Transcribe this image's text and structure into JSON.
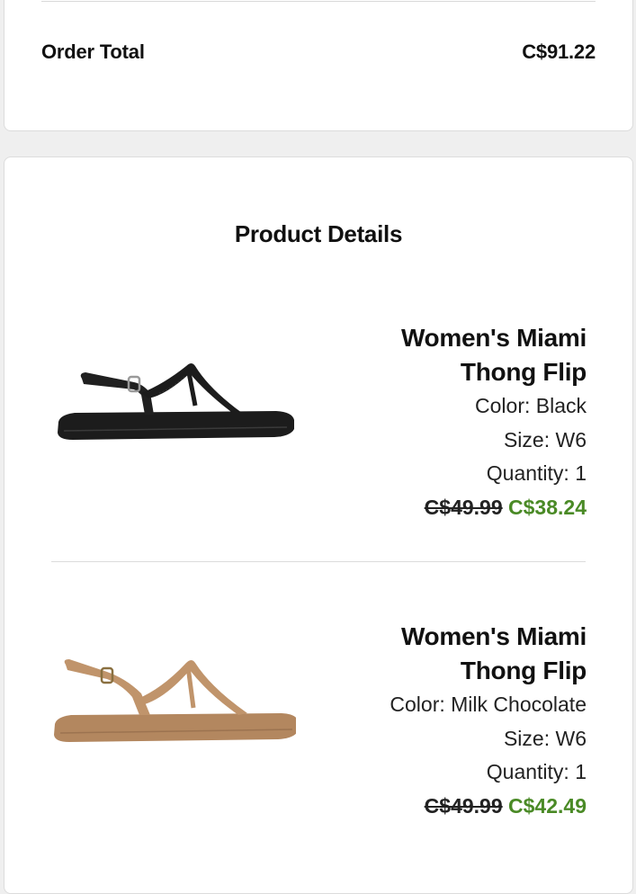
{
  "order_summary": {
    "total_label": "Order Total",
    "total_value": "C$91.22"
  },
  "product_details": {
    "title": "Product Details",
    "items": [
      {
        "name_line1": "Women's Miami",
        "name_line2": "Thong Flip",
        "color": "Color: Black",
        "size": "Size: W6",
        "quantity": "Quantity: 1",
        "original_price": "C$49.99",
        "sale_price": "C$38.24",
        "swatch": "#1c1c1c"
      },
      {
        "name_line1": "Women's Miami",
        "name_line2": "Thong Flip",
        "color": "Color: Milk Chocolate",
        "size": "Size: W6",
        "quantity": "Quantity: 1",
        "original_price": "C$49.99",
        "sale_price": "C$42.49",
        "swatch": "#b98d66"
      }
    ]
  },
  "colors": {
    "sale_green": "#4a8a26",
    "background": "#efefef"
  }
}
